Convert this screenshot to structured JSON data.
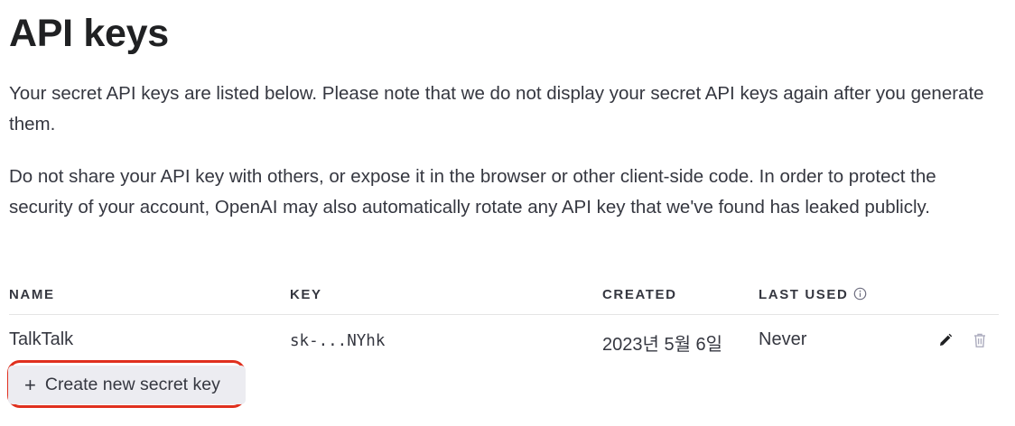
{
  "page": {
    "title": "API keys",
    "intro": "Your secret API keys are listed below. Please note that we do not display your secret API keys again after you generate them.",
    "warning": "Do not share your API key with others, or expose it in the browser or other client-side code. In order to protect the security of your account, OpenAI may also automatically rotate any API key that we've found has leaked publicly."
  },
  "table": {
    "headers": {
      "name": "NAME",
      "key": "KEY",
      "created": "CREATED",
      "last_used": "LAST USED"
    },
    "rows": [
      {
        "name": "TalkTalk",
        "key": "sk-...NYhk",
        "created": "2023년 5월 6일",
        "last_used": "Never"
      }
    ]
  },
  "actions": {
    "create_label": "Create new secret key"
  },
  "icons": {
    "info": "info-icon",
    "edit": "pencil-icon",
    "delete": "trash-icon",
    "add": "plus-icon"
  },
  "colors": {
    "highlight": "#e0301e",
    "button_bg": "#ececf1"
  }
}
